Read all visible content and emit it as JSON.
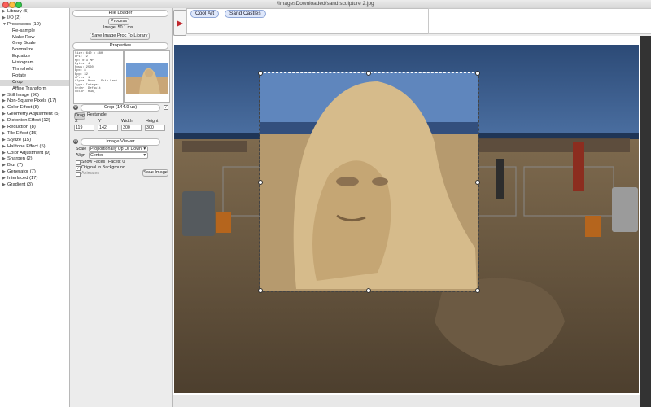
{
  "window": {
    "title": "/ImagesDownloaded/sand sculpture 2.jpg"
  },
  "sidebar": {
    "items": [
      {
        "label": "Library (5)",
        "expanded": false,
        "child": false
      },
      {
        "label": "I/O (2)",
        "expanded": false,
        "child": false
      },
      {
        "label": "Processors (10)",
        "expanded": true,
        "child": false
      },
      {
        "label": "Re-sample",
        "child": true
      },
      {
        "label": "Make Row",
        "child": true
      },
      {
        "label": "Grey Scale",
        "child": true
      },
      {
        "label": "Normalize",
        "child": true
      },
      {
        "label": "Equalize",
        "child": true
      },
      {
        "label": "Histogram",
        "child": true
      },
      {
        "label": "Threshold",
        "child": true
      },
      {
        "label": "Rotate",
        "child": true
      },
      {
        "label": "Crop",
        "child": true,
        "selected": true
      },
      {
        "label": "Affine Transform",
        "child": true
      },
      {
        "label": "Still Image (96)",
        "expanded": false,
        "child": false
      },
      {
        "label": "Non-Square Pixels (17)",
        "expanded": false,
        "child": false
      },
      {
        "label": "Color Effect (8)",
        "expanded": false,
        "child": false
      },
      {
        "label": "Geometry Adjustment (5)",
        "expanded": false,
        "child": false
      },
      {
        "label": "Distortion Effect (12)",
        "expanded": false,
        "child": false
      },
      {
        "label": "Reduction (8)",
        "expanded": false,
        "child": false
      },
      {
        "label": "Tile Effect (15)",
        "expanded": false,
        "child": false
      },
      {
        "label": "Stylize (15)",
        "expanded": false,
        "child": false
      },
      {
        "label": "Halftone Effect (5)",
        "expanded": false,
        "child": false
      },
      {
        "label": "Color Adjustment (9)",
        "expanded": false,
        "child": false
      },
      {
        "label": "Sharpen (2)",
        "expanded": false,
        "child": false
      },
      {
        "label": "Blur (7)",
        "expanded": false,
        "child": false
      },
      {
        "label": "Generator (7)",
        "expanded": false,
        "child": false
      },
      {
        "label": "Interlaced (17)",
        "expanded": false,
        "child": false
      },
      {
        "label": "Gradient (3)",
        "expanded": false,
        "child": false
      }
    ]
  },
  "file_loader": {
    "title": "File Loader",
    "process_label": "Process",
    "image_time": "Image: 50.1 ms",
    "save_label": "Save Image Proc To Library"
  },
  "properties": {
    "title": "Properties",
    "lines": [
      "Size: 640 x 480",
      "DPI:  72",
      "Mp:   0.3 MP",
      "Bytes: 4",
      "Rows: 2560",
      "Bpc:  8",
      "Bpp:  32",
      "#Prev: 1",
      "Alpha: None - Skip Last",
      "Type: Integer",
      "Order: Default",
      "Color: RGB_"
    ]
  },
  "crop": {
    "title": "Crop",
    "time": "(144.9 us)",
    "mode_options": [
      "Drag",
      "Rectangle"
    ],
    "x_label": "X",
    "y_label": "Y",
    "width_label": "Width",
    "height_label": "Height",
    "x": "119",
    "y": "142",
    "width": "300",
    "height": "300"
  },
  "image_viewer": {
    "title": "Image Viewer",
    "scale_label": "Scale",
    "scale_value": "Proportionally Up Or Down",
    "align_label": "Align",
    "align_value": "Center",
    "show_faces_label": "Show Faces",
    "faces_count": "Faces: 0",
    "original_bg_label": "Original In Background",
    "animates_label": "Animates",
    "save_image_label": "Save Image",
    "show_faces_checked": false,
    "original_bg_checked": true,
    "animates_checked": false
  },
  "tags": [
    "Cool Art",
    "Sand Castles"
  ],
  "colors": {
    "accent_red": "#c0272d",
    "tag_blue": "#dfe8fb",
    "sky": "#4a6ea0",
    "sand": "#c9ab7a"
  }
}
